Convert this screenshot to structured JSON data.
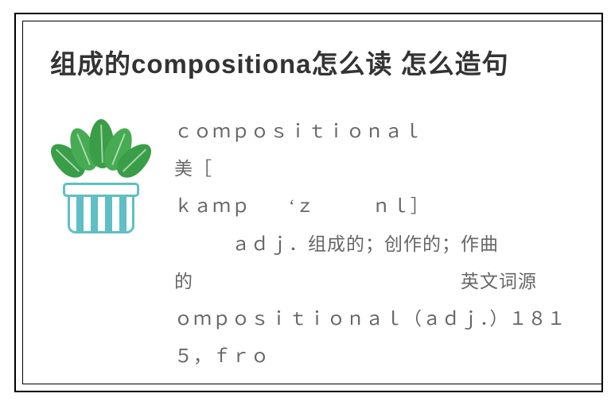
{
  "title": "组成的compositiona怎么读 怎么造句",
  "body_lines": [
    "ｃｏｍｐｏｓｉｔｉｏｎａｌ　　　　　　　　　　美［",
    "ｋａｍｐ　　‘ｚ　　　ｎｌ］",
    "　　　ａｄｊ．组成的；创作的；作曲",
    "的　　　　　　　　　　　　　　英文词源",
    "ｏｍｐｏｓｉｔｉｏｎａｌ（ａｄｊ．）１８１５，ｆｒｏ"
  ]
}
